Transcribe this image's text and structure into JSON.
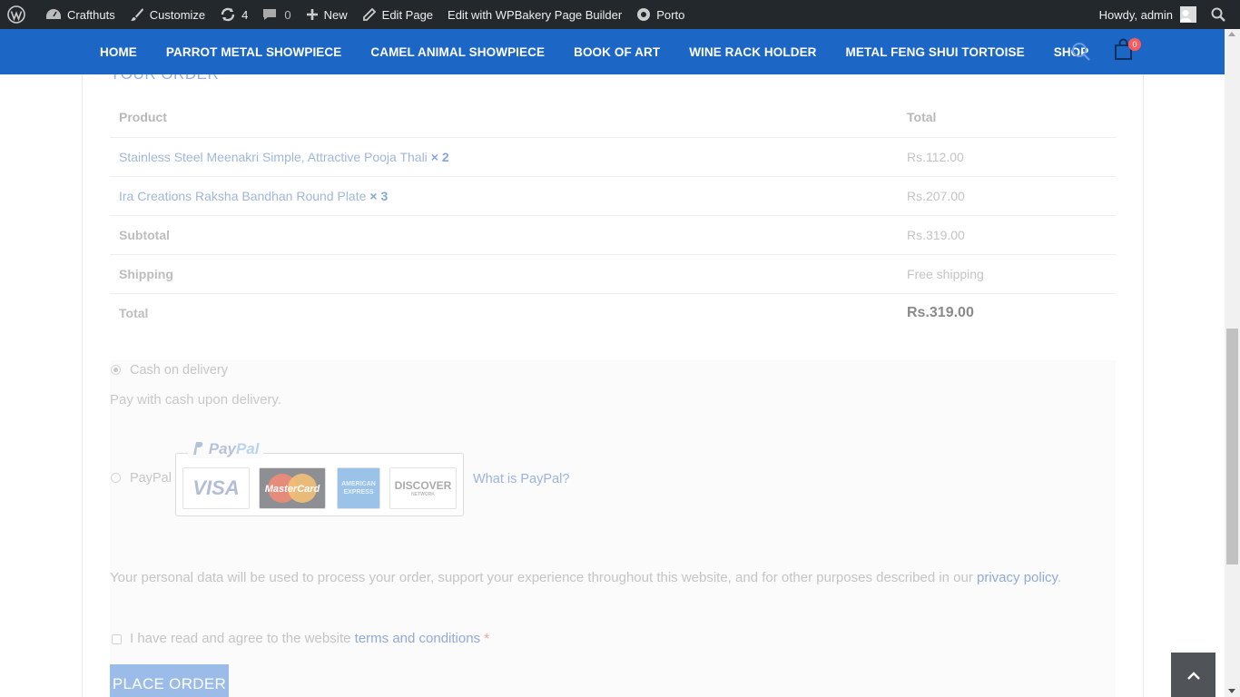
{
  "adminbar": {
    "site_name": "Crafthuts",
    "customize": "Customize",
    "updates_count": "4",
    "comments_count": "0",
    "new": "New",
    "edit_page": "Edit Page",
    "wpbakery": "Edit with WPBakery Page Builder",
    "theme": "Porto",
    "greeting": "Howdy, admin"
  },
  "nav": {
    "items": [
      "HOME",
      "PARROT METAL SHOWPIECE",
      "CAMEL ANIMAL SHOWPIECE",
      "BOOK OF ART",
      "WINE RACK HOLDER",
      "METAL FENG SHUI TORTOISE",
      "SHOP"
    ],
    "cart_count": "0"
  },
  "order": {
    "title": "YOUR ORDER",
    "head_product": "Product",
    "head_total": "Total",
    "items": [
      {
        "name": "Stainless Steel Meenakri Simple, Attractive Pooja Thali",
        "qty": "× 2",
        "total": "Rs.112.00"
      },
      {
        "name": "Ira Creations Raksha Bandhan Round Plate",
        "qty": "× 3",
        "total": "Rs.207.00"
      }
    ],
    "subtotal_label": "Subtotal",
    "subtotal_value": "Rs.319.00",
    "shipping_label": "Shipping",
    "shipping_value": "Free shipping",
    "total_label": "Total",
    "total_value": "Rs.319.00"
  },
  "payment": {
    "cod_label": "Cash on delivery",
    "cod_desc": "Pay with cash upon delivery.",
    "paypal_label": "PayPal",
    "paypal_logo_pay": "Pay",
    "paypal_logo_pal": "Pal",
    "card_visa": "VISA",
    "card_mastercard": "MasterCard",
    "card_amex": "AMERICAN EXPRESS",
    "card_discover": "DISCOVER",
    "card_discover_sub": "NETWORK",
    "what_is_paypal": "What is PayPal?",
    "privacy_text": "Your personal data will be used to process your order, support your experience throughout this website, and for other purposes described in our ",
    "privacy_link": "privacy policy",
    "privacy_end": ".",
    "terms_text": "I have read and agree to the website ",
    "terms_link": "terms and conditions",
    "terms_required": "*",
    "place_order": "PLACE ORDER"
  }
}
